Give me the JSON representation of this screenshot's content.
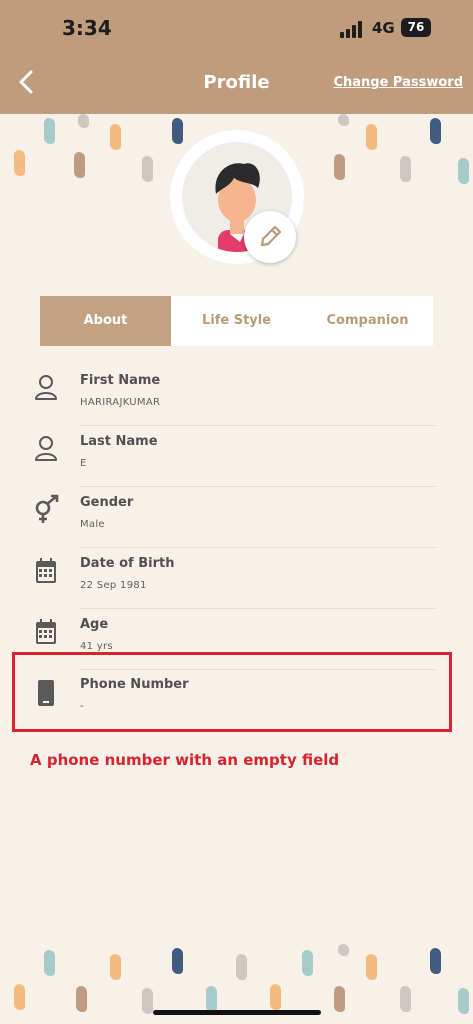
{
  "status_bar": {
    "time": "3:34",
    "network": "4G",
    "battery": "76"
  },
  "nav": {
    "title": "Profile",
    "change_password": "Change Password"
  },
  "tabs": [
    {
      "label": "About",
      "active": true
    },
    {
      "label": "Life Style",
      "active": false
    },
    {
      "label": "Companion",
      "active": false
    }
  ],
  "fields": [
    {
      "label": "First Name",
      "value": "HARIRAJKUMAR",
      "icon": "person-icon"
    },
    {
      "label": "Last Name",
      "value": "E",
      "icon": "person-icon"
    },
    {
      "label": "Gender",
      "value": "Male",
      "icon": "gender-icon"
    },
    {
      "label": "Date of Birth",
      "value": "22 Sep 1981",
      "icon": "calendar-icon"
    },
    {
      "label": "Age",
      "value": "41 yrs",
      "icon": "calendar-icon"
    },
    {
      "label": "Phone Number",
      "value": "-",
      "icon": "phone-icon"
    }
  ],
  "annotation": {
    "text": "A phone number with an empty field",
    "color": "#d9232e"
  },
  "colors": {
    "header": "#bf9c7c",
    "accent": "#c3a283",
    "background": "#f8f1ea"
  }
}
